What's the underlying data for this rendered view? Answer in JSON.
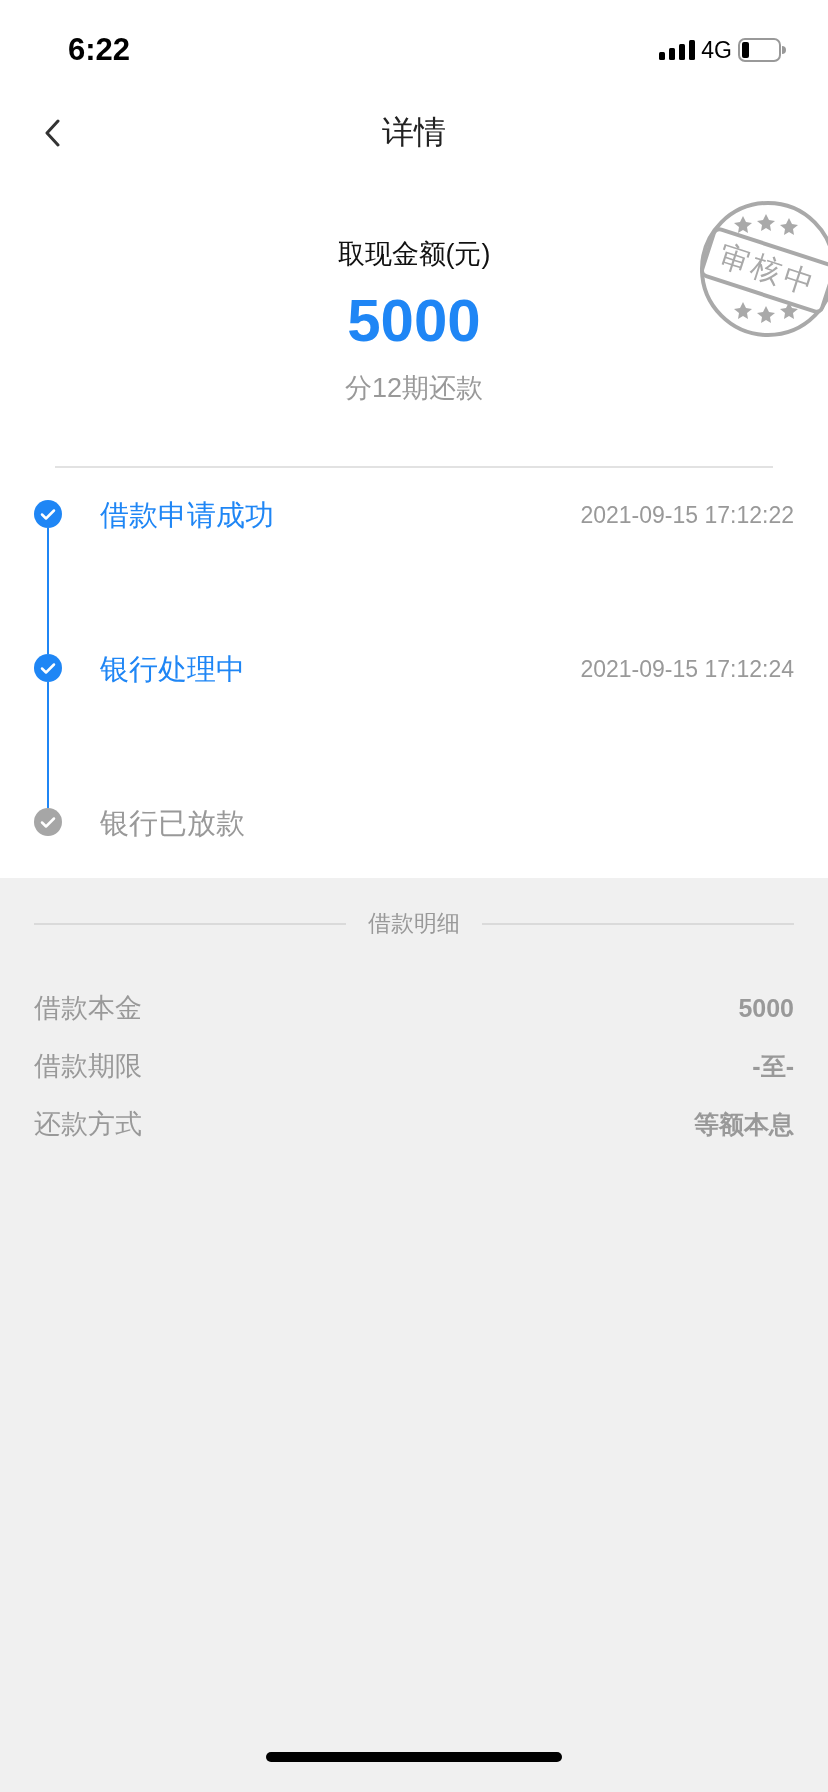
{
  "status_bar": {
    "time": "6:22",
    "network": "4G"
  },
  "nav": {
    "title": "详情"
  },
  "summary": {
    "label": "取现金额(元)",
    "amount": "5000",
    "installments": "分12期还款",
    "stamp": "审核中"
  },
  "timeline": [
    {
      "title": "借款申请成功",
      "time": "2021-09-15 17:12:22",
      "done": true
    },
    {
      "title": "银行处理中",
      "time": "2021-09-15 17:12:24",
      "done": true
    },
    {
      "title": "银行已放款",
      "done": false
    }
  ],
  "details": {
    "heading": "借款明细",
    "rows": [
      {
        "label": "借款本金",
        "value": "5000"
      },
      {
        "label": "借款期限",
        "value": "-至-"
      },
      {
        "label": "还款方式",
        "value": "等额本息"
      }
    ]
  }
}
